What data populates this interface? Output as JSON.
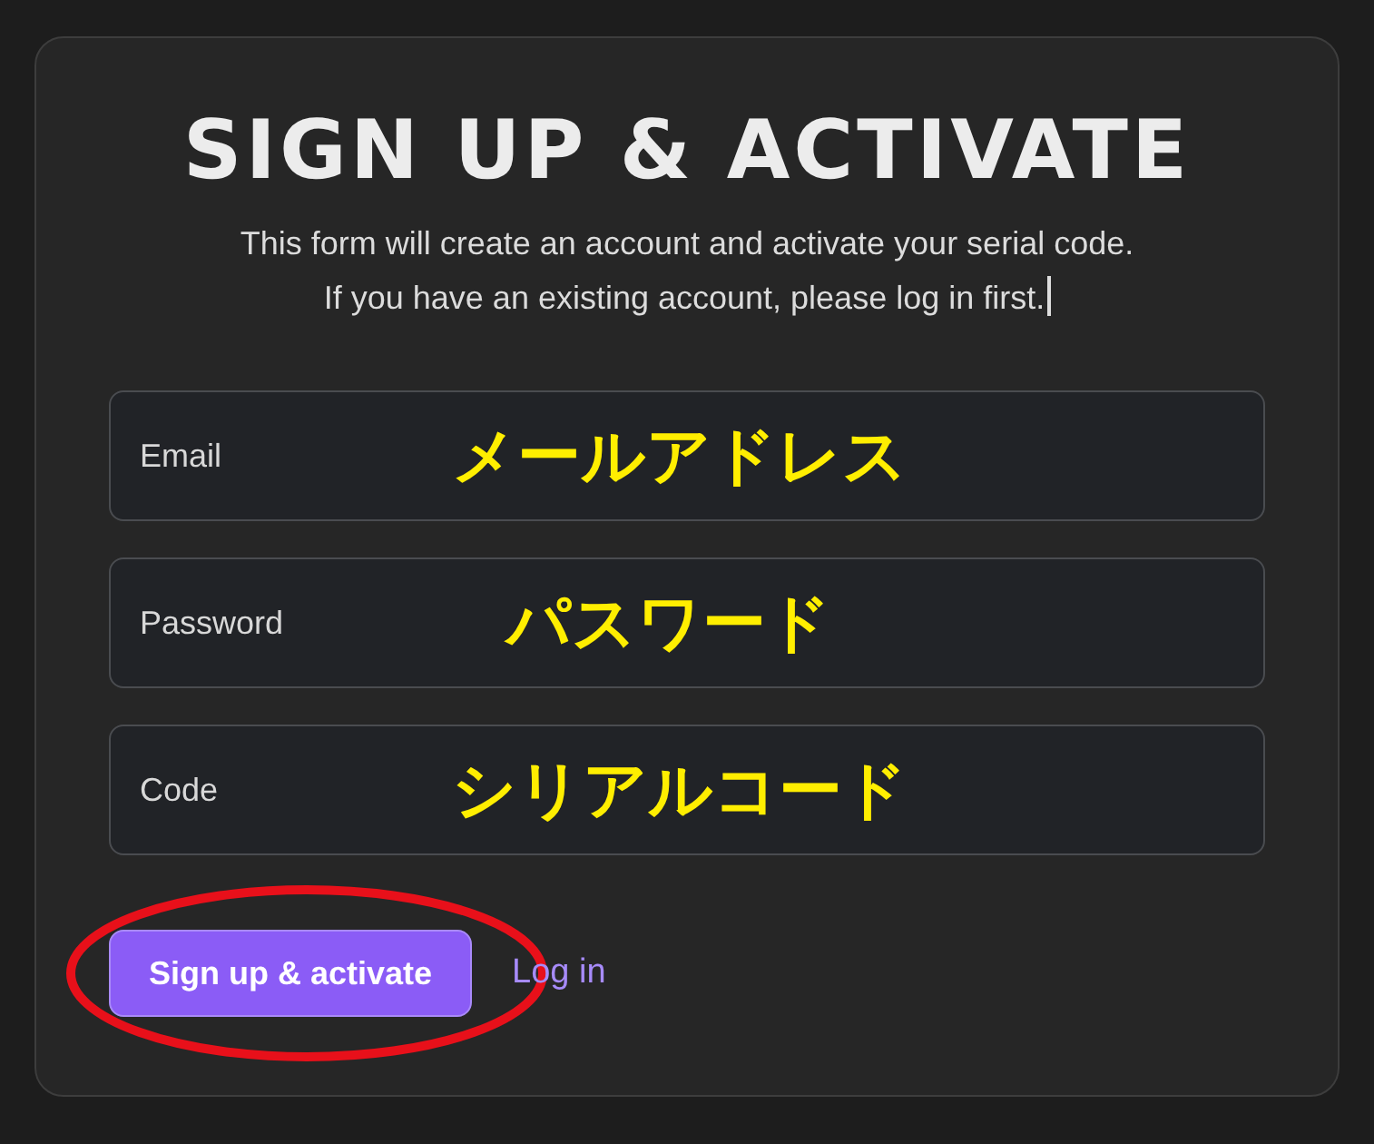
{
  "title": "SIGN UP & ACTIVATE",
  "description": [
    "This form will create an account and activate your serial code.",
    "If you have an existing account, please log in first."
  ],
  "fields": [
    {
      "placeholder": "Email",
      "annotation": "メールアドレス"
    },
    {
      "placeholder": "Password",
      "annotation": "パスワード"
    },
    {
      "placeholder": "Code",
      "annotation": "シリアルコード"
    }
  ],
  "submit_button": {
    "label": "Sign up & activate",
    "highlighted": true
  },
  "login_link": "Log in"
}
